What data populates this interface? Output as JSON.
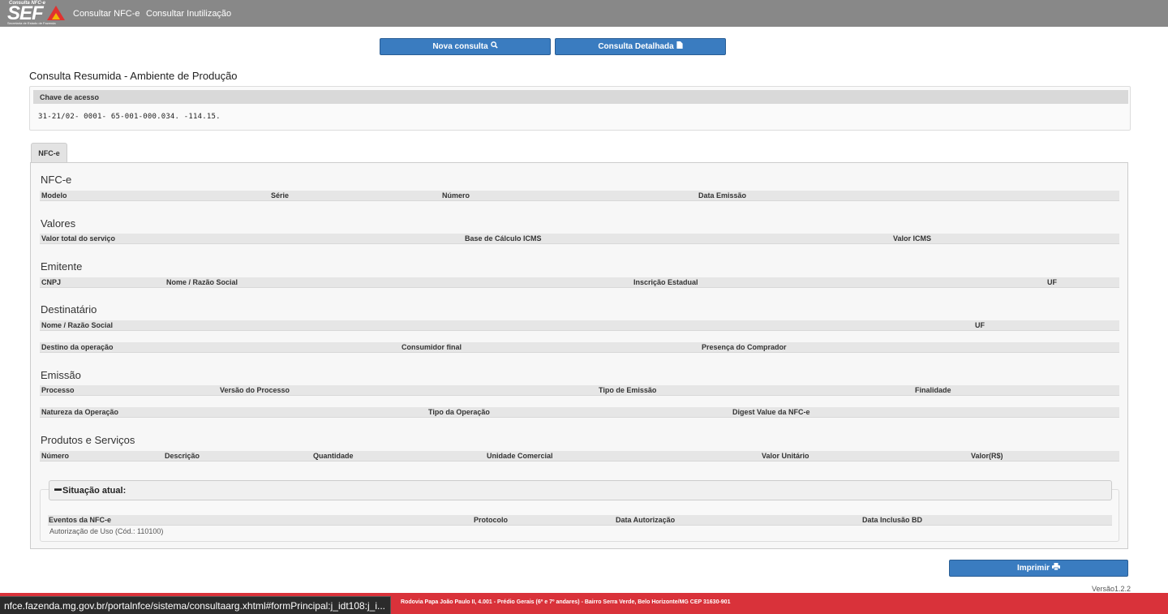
{
  "logo": {
    "top_text": "Consulta NFC-e",
    "big_text": "SEF",
    "sub_text": "Secretaria de Estado de Fazenda"
  },
  "nav": [
    "Consultar NFC-e",
    "Consultar Inutilização"
  ],
  "buttons": {
    "nova_consulta": "Nova consulta",
    "consulta_detalhada": "Consulta Detalhada",
    "imprimir": "Imprimir"
  },
  "page_title": "Consulta Resumida - Ambiente de Produção",
  "chave": {
    "label": "Chave de acesso",
    "value": "31-21/02-                    0001-      65-001-000.034.         -114.15."
  },
  "tab_label": "NFC-e",
  "sections": {
    "nfce": {
      "title": "NFC-e",
      "headers": [
        "Modelo",
        "Série",
        "Número",
        "Data Emissão"
      ]
    },
    "valores": {
      "title": "Valores",
      "headers": [
        "Valor total do serviço",
        "Base de Cálculo ICMS",
        "Valor ICMS"
      ]
    },
    "emitente": {
      "title": "Emitente",
      "headers": [
        "CNPJ",
        "Nome / Razão Social",
        "Inscrição Estadual",
        "UF"
      ]
    },
    "destinatario": {
      "title": "Destinatário",
      "headers": [
        "Nome / Razão Social",
        "UF"
      ],
      "headers2": [
        "Destino da operação",
        "Consumidor final",
        "Presença do Comprador"
      ]
    },
    "emissao": {
      "title": "Emissão",
      "headers": [
        "Processo",
        "Versão do Processo",
        "Tipo de Emissão",
        "Finalidade"
      ],
      "headers2": [
        "Natureza da Operação",
        "Tipo da Operação",
        "Digest Value da NFC-e"
      ]
    },
    "produtos": {
      "title": "Produtos e Serviços",
      "headers": [
        "Número",
        "Descrição",
        "Quantidade",
        "Unidade Comercial",
        "Valor Unitário",
        "Valor(R$)"
      ]
    }
  },
  "situacao": {
    "title": "Situação atual:",
    "headers": [
      "Eventos da NFC-e",
      "Protocolo",
      "Data Autorização",
      "Data Inclusão BD"
    ],
    "evento": "Autorização de Uso (Cód.: 110100)"
  },
  "version": "Versão1.2.2",
  "footer": "Rodovia Papa João Paulo II, 4.001 - Prédio Gerais (6º e 7º andares) - Bairro Serra Verde, Belo Horizonte/MG CEP 31630-901",
  "status_url": "nfce.fazenda.mg.gov.br/portalnfce/sistema/consultaarg.xhtml#formPrincipal:j_idt108:j_i...",
  "colors": {
    "topbar": "#888888",
    "button": "#3a7cc0",
    "footer": "#d9323a"
  }
}
